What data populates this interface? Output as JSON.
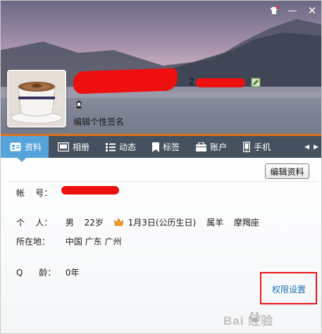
{
  "window_controls": {
    "skin_icon": "skin-icon",
    "minimize_glyph": "—",
    "close_glyph": "✕"
  },
  "profile": {
    "qq_prefix": "2",
    "signature": "编辑个性签名"
  },
  "tabs": [
    {
      "label": "资料",
      "icon": "profile-card-icon",
      "active": true
    },
    {
      "label": "相册",
      "icon": "photo-icon",
      "active": false
    },
    {
      "label": "动态",
      "icon": "feed-icon",
      "active": false
    },
    {
      "label": "标签",
      "icon": "bookmark-icon",
      "active": false
    },
    {
      "label": "账户",
      "icon": "wallet-icon",
      "active": false
    },
    {
      "label": "手机",
      "icon": "phone-icon",
      "active": false
    }
  ],
  "edit_info_label": "编辑资料",
  "info": {
    "account_label": "帐    号：",
    "person_label": "个    人：",
    "gender": "男",
    "age": "22岁",
    "birthday": "1月3日(公历生日)",
    "zodiac": "属羊",
    "constellation": "摩羯座",
    "location_label": "所在地：",
    "location": "中国 广东 广州",
    "qage_label": "Q      龄：",
    "qage": "0年"
  },
  "permission_label": "权限设置",
  "watermark": "Bai 经验",
  "colors": {
    "tabbar": "#45515f",
    "tab_active": "#55a3db",
    "tab_accent": "#e0731c",
    "link": "#1d6fb8",
    "highlight": "#e81515",
    "redaction": "#ee0f0f"
  }
}
